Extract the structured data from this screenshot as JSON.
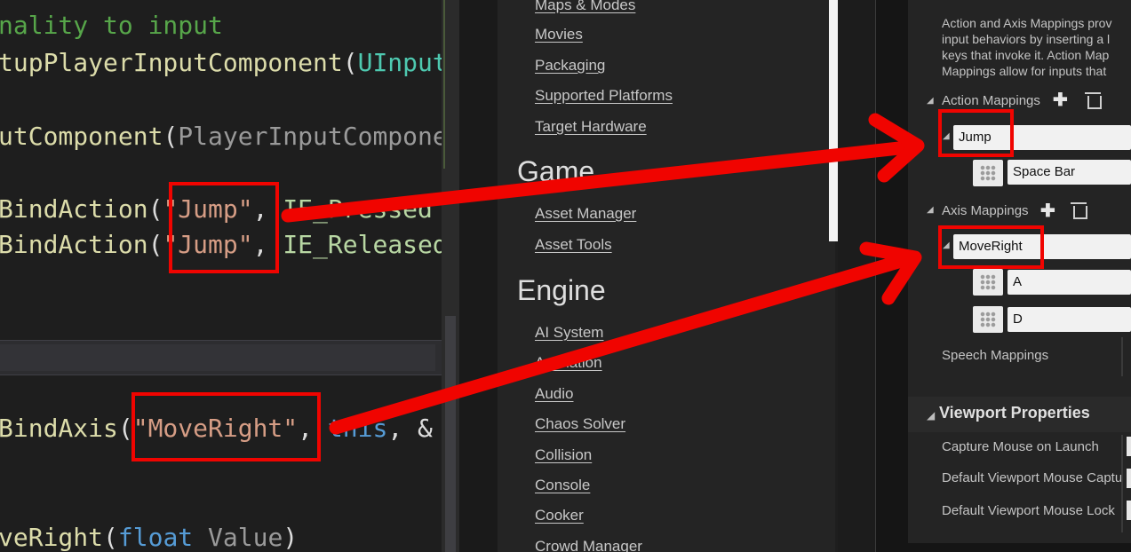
{
  "code": {
    "lines": [
      {
        "parts": [
          {
            "t": "nality to input",
            "c": "comment"
          }
        ]
      },
      {
        "parts": [
          {
            "t": "tupPlayerInputComponent",
            "c": "func"
          },
          {
            "t": "(",
            "c": "plain"
          },
          {
            "t": "UInput",
            "c": "type"
          }
        ]
      },
      {
        "parts": [
          {
            "t": "utComponent",
            "c": "func"
          },
          {
            "t": "(",
            "c": "plain"
          },
          {
            "t": "PlayerInputCompone",
            "c": "var"
          }
        ]
      },
      {
        "parts": [
          {
            "t": "BindAction",
            "c": "func"
          },
          {
            "t": "(",
            "c": "plain"
          },
          {
            "t": "\"Jump\"",
            "c": "str"
          },
          {
            "t": ", ",
            "c": "plain"
          },
          {
            "t": "IE_Pressed",
            "c": "enum"
          }
        ]
      },
      {
        "parts": [
          {
            "t": "BindAction",
            "c": "func"
          },
          {
            "t": "(",
            "c": "plain"
          },
          {
            "t": "\"Jump\"",
            "c": "str"
          },
          {
            "t": ", ",
            "c": "plain"
          },
          {
            "t": "IE_Released",
            "c": "enum"
          }
        ]
      },
      {
        "parts": [
          {
            "t": "BindAxis",
            "c": "func"
          },
          {
            "t": "(",
            "c": "plain"
          },
          {
            "t": "\"MoveRight\"",
            "c": "str"
          },
          {
            "t": ", ",
            "c": "plain"
          },
          {
            "t": "this",
            "c": "kw"
          },
          {
            "t": ", &",
            "c": "plain"
          }
        ]
      },
      {
        "parts": [
          {
            "t": "veRight",
            "c": "func"
          },
          {
            "t": "(",
            "c": "plain"
          },
          {
            "t": "float",
            "c": "kw"
          },
          {
            "t": " ",
            "c": "plain"
          },
          {
            "t": "Value",
            "c": "var"
          },
          {
            "t": ")",
            "c": "plain"
          }
        ]
      }
    ]
  },
  "nav": {
    "project_items": [
      "Maps & Modes",
      "Movies",
      "Packaging",
      "Supported Platforms",
      "Target Hardware"
    ],
    "game_heading": "Game",
    "game_items": [
      "Asset Manager",
      "Asset Tools"
    ],
    "engine_heading": "Engine",
    "engine_items": [
      "AI System",
      "Animation",
      "Audio",
      "Chaos Solver",
      "Collision",
      "Console",
      "Cooker",
      "Crowd Manager"
    ]
  },
  "details": {
    "description": "Action and Axis Mappings prov\ninput behaviors by inserting a l\nkeys that invoke it. Action Map\nMappings allow for inputs that",
    "action_mappings_label": "Action Mappings",
    "action_name": "Jump",
    "action_key": "Space Bar",
    "axis_mappings_label": "Axis Mappings",
    "axis_name": "MoveRight",
    "axis_key_1": "A",
    "axis_key_2": "D",
    "speech_mappings_label": "Speech Mappings",
    "viewport_section": "Viewport Properties",
    "viewport_rows": [
      "Capture Mouse on Launch",
      "Default Viewport Mouse Captu",
      "Default Viewport Mouse Lock"
    ]
  },
  "colors": {
    "annotation": "#f00400",
    "link_text": "#c8c8c8",
    "code_comment": "#57a64a",
    "code_function": "#dcdcaa",
    "code_string": "#d69d85",
    "code_keyword": "#569cd6"
  },
  "icons": [
    "plus-icon",
    "trash-icon",
    "key-selector-icon",
    "collapse-triangle-icon"
  ]
}
